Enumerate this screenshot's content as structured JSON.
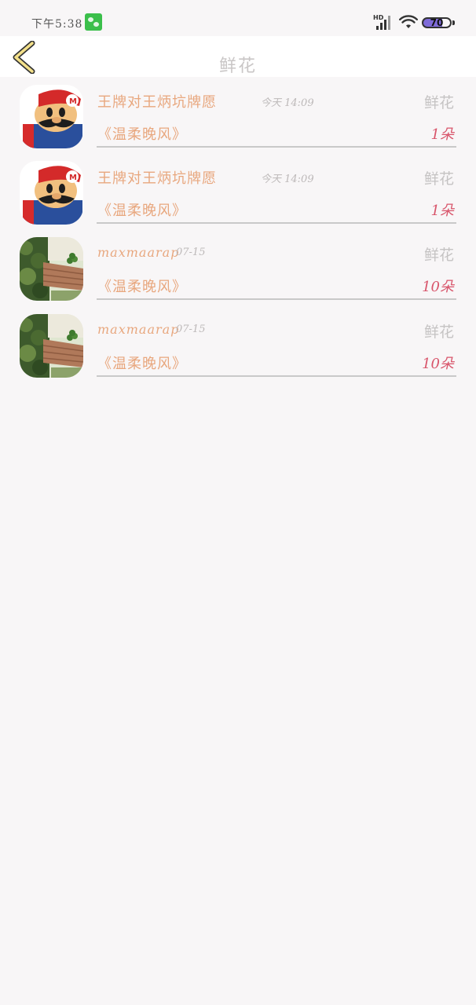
{
  "status_bar": {
    "time": "下午5:38",
    "network": "HD",
    "battery": "70"
  },
  "nav": {
    "title": "鲜花"
  },
  "colors": {
    "name_accent": "#e8a77e",
    "count_accent": "#d8556b",
    "muted": "#c5c3c3"
  },
  "list": {
    "items": [
      {
        "avatar": "mario-avatar",
        "name": "王牌对王炳坑牌愿",
        "time": "今天 14:09",
        "type": "鲜花",
        "work": "《温柔晚风》",
        "count": "1朵"
      },
      {
        "avatar": "mario-avatar",
        "name": "王牌对王炳坑牌愿",
        "time": "今天 14:09",
        "type": "鲜花",
        "work": "《温柔晚风》",
        "count": "1朵"
      },
      {
        "avatar": "plant-avatar",
        "name": "maxmaarap",
        "time": "07-15",
        "type": "鲜花",
        "work": "《温柔晚风》",
        "count": "10朵"
      },
      {
        "avatar": "plant-avatar",
        "name": "maxmaarap",
        "time": "07-15",
        "type": "鲜花",
        "work": "《温柔晚风》",
        "count": "10朵"
      }
    ]
  }
}
